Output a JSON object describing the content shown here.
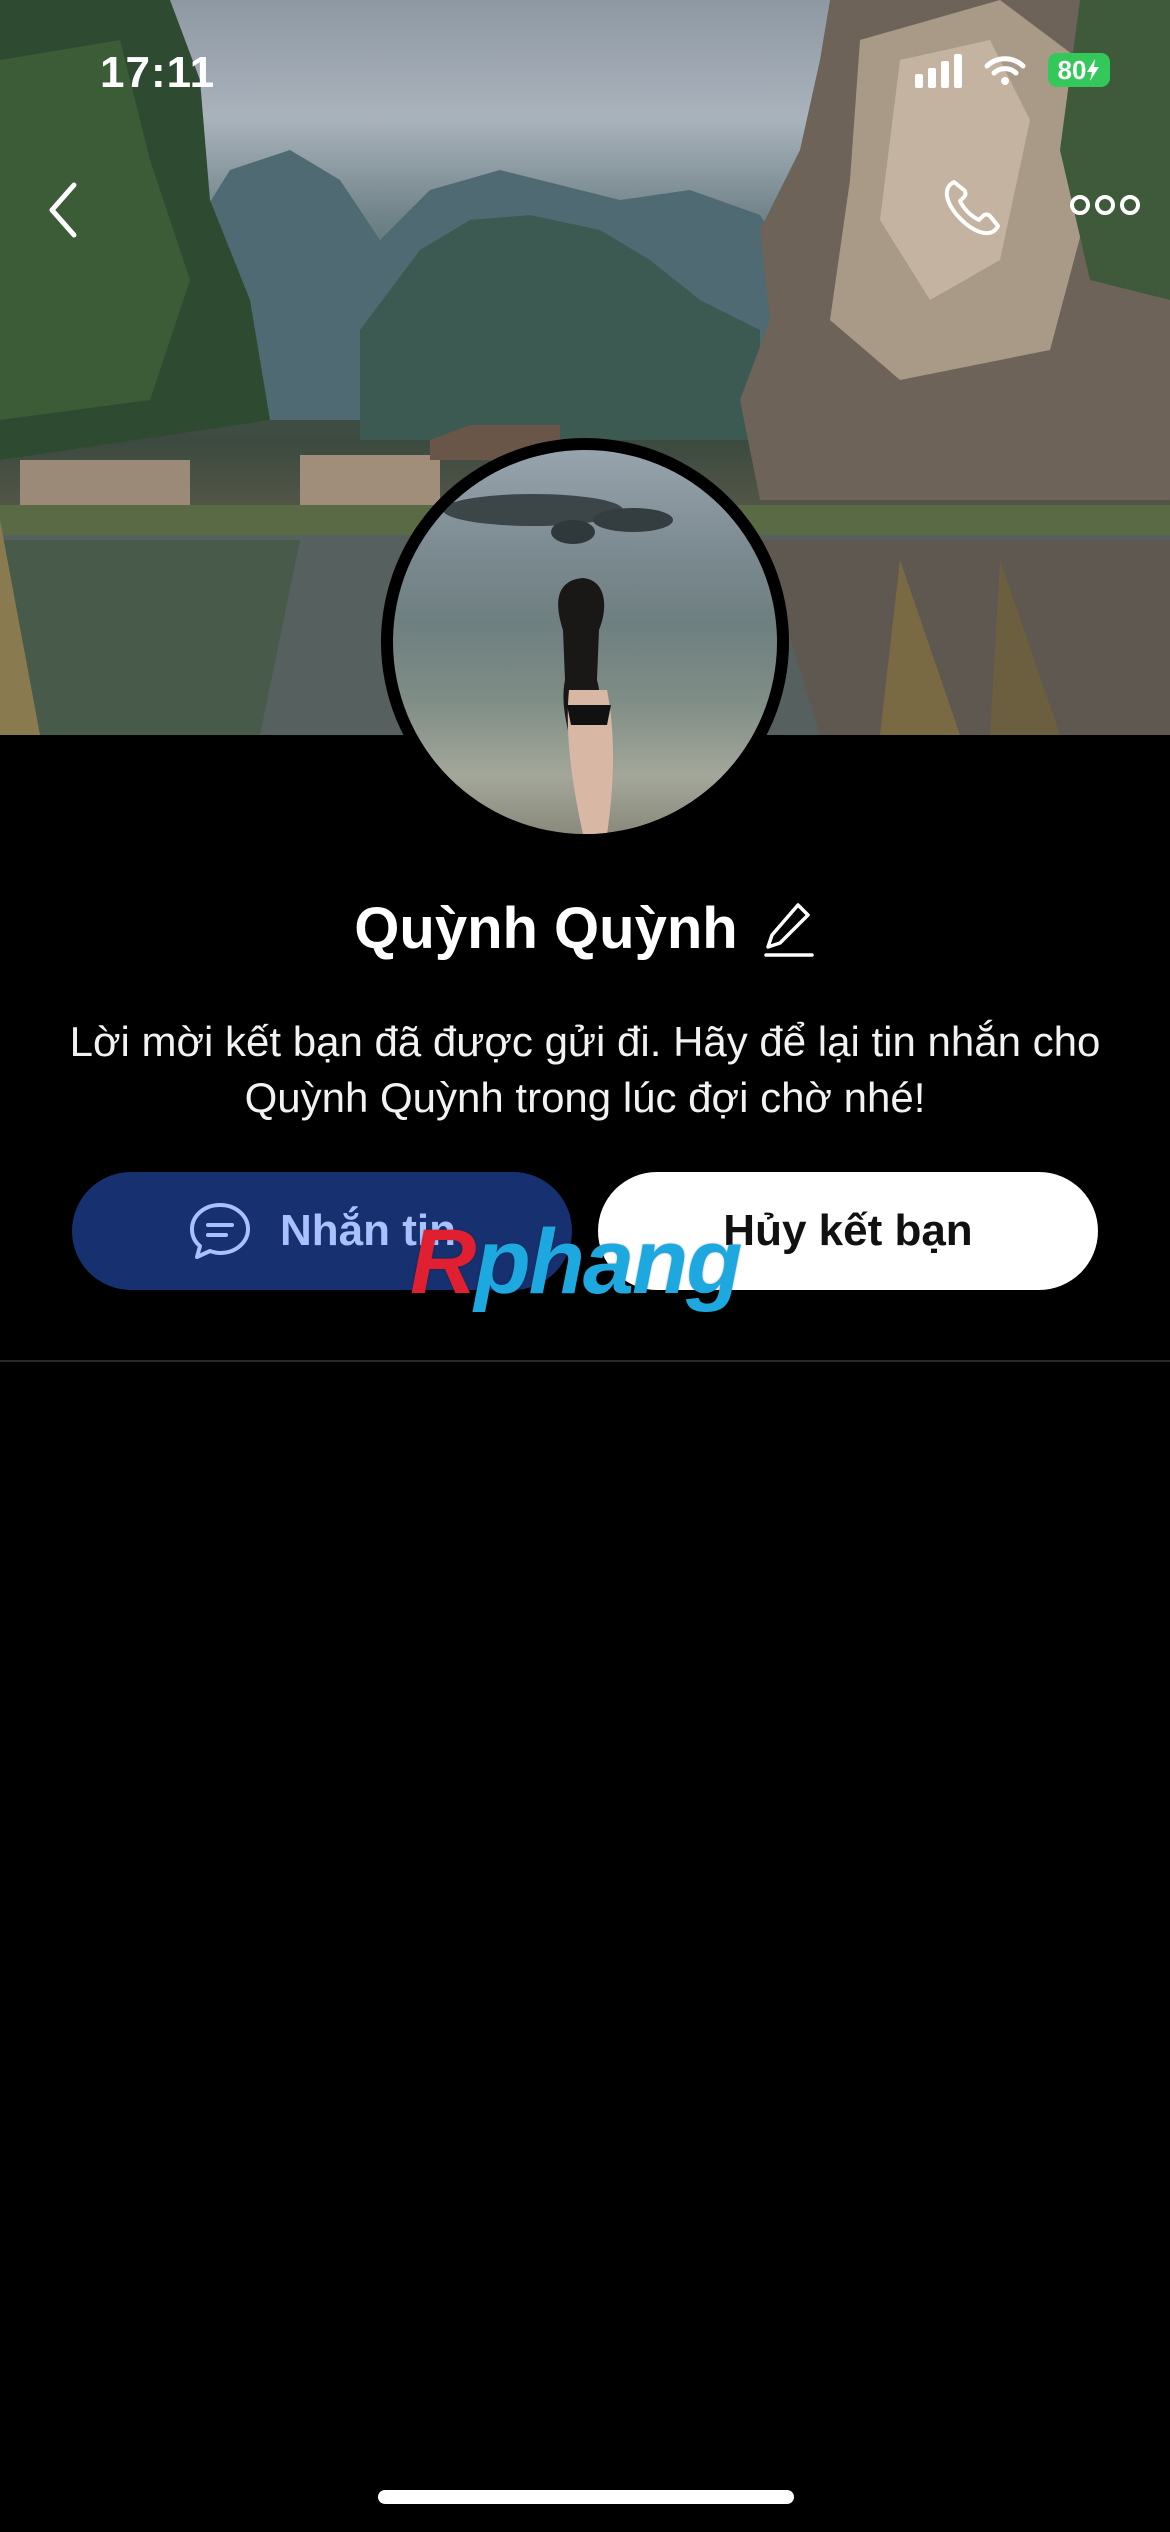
{
  "status_bar": {
    "time": "17:11",
    "battery": "80"
  },
  "nav": {
    "back_icon": "chevron-left-icon",
    "call_icon": "phone-icon",
    "more_icon": "more-dots-icon"
  },
  "profile": {
    "name": "Quỳnh Quỳnh",
    "edit_icon": "pencil-icon",
    "message": "Lời mời kết bạn đã được gửi đi. Hãy để lại tin nhắn cho Quỳnh Quỳnh trong lúc đợi chờ nhé!"
  },
  "actions": {
    "message_label": "Nhắn tin",
    "message_icon": "chat-bubble-icon",
    "cancel_label": "Hủy kết bạn"
  },
  "watermark": {
    "first": "R",
    "rest": "phang"
  },
  "colors": {
    "background": "#000000",
    "message_button_bg": "#17306f",
    "message_button_text": "#a9c2ff",
    "cancel_button_bg": "#ffffff",
    "battery": "#34c759"
  }
}
